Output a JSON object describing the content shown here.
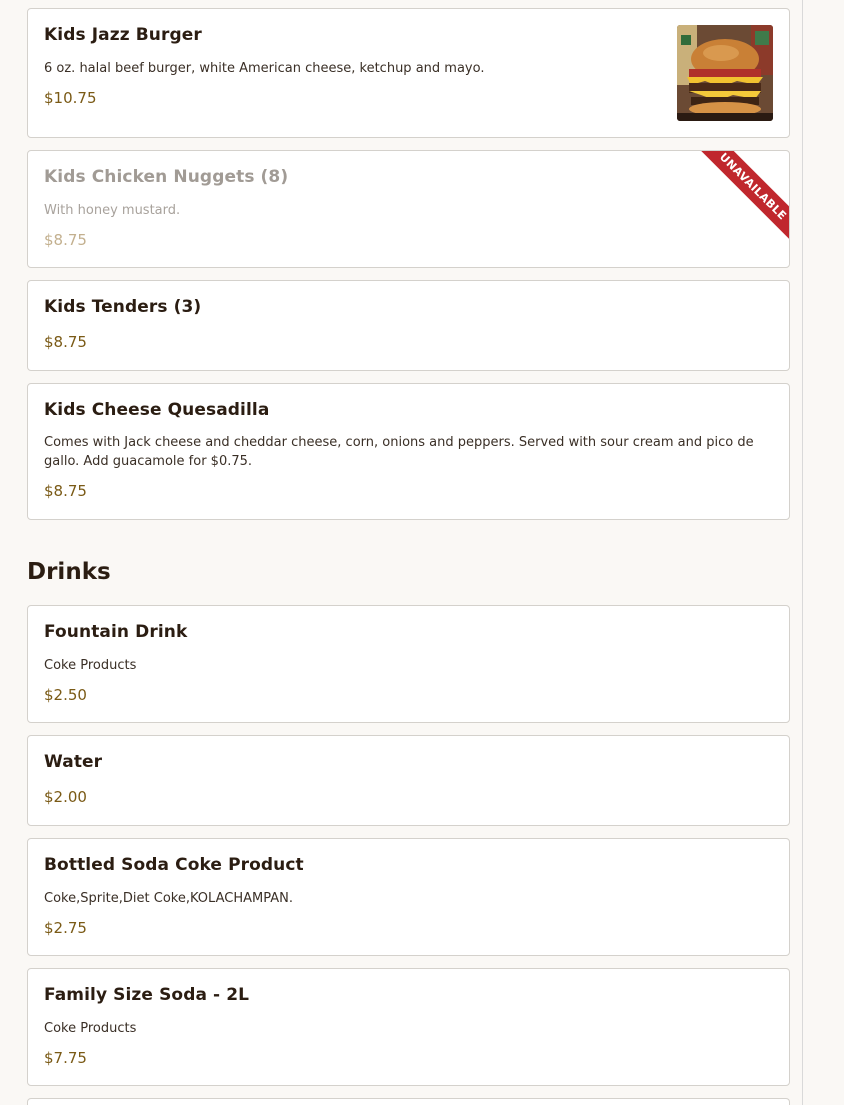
{
  "sections": [
    {
      "items": [
        {
          "name": "Kids Jazz Burger",
          "description": "6 oz. halal beef burger, white American cheese, ketchup and mayo.",
          "price": "$10.75"
        },
        {
          "name": "Kids Chicken Nuggets (8)",
          "description": "With honey mustard.",
          "price": "$8.75",
          "badge": "UNAVAILABLE"
        },
        {
          "name": "Kids Tenders (3)",
          "price": "$8.75"
        },
        {
          "name": "Kids Cheese Quesadilla",
          "description": "Comes with Jack cheese and cheddar cheese, corn, onions and peppers. Served with sour cream and pico de gallo. Add guacamole for $0.75.",
          "price": "$8.75"
        }
      ]
    },
    {
      "heading": "Drinks",
      "items": [
        {
          "name": "Fountain Drink",
          "description": "Coke Products",
          "price": "$2.50"
        },
        {
          "name": "Water",
          "price": "$2.00"
        },
        {
          "name": "Bottled Soda Coke Product",
          "description": "Coke,Sprite,Diet Coke,KOLACHAMPAN.",
          "price": "$2.75"
        },
        {
          "name": "Family Size Soda - 2L",
          "description": "Coke Products",
          "price": "$7.75"
        }
      ]
    }
  ],
  "colors": {
    "price": "#7a5a16",
    "badge": "#c0272d",
    "title": "#2b1d12"
  }
}
